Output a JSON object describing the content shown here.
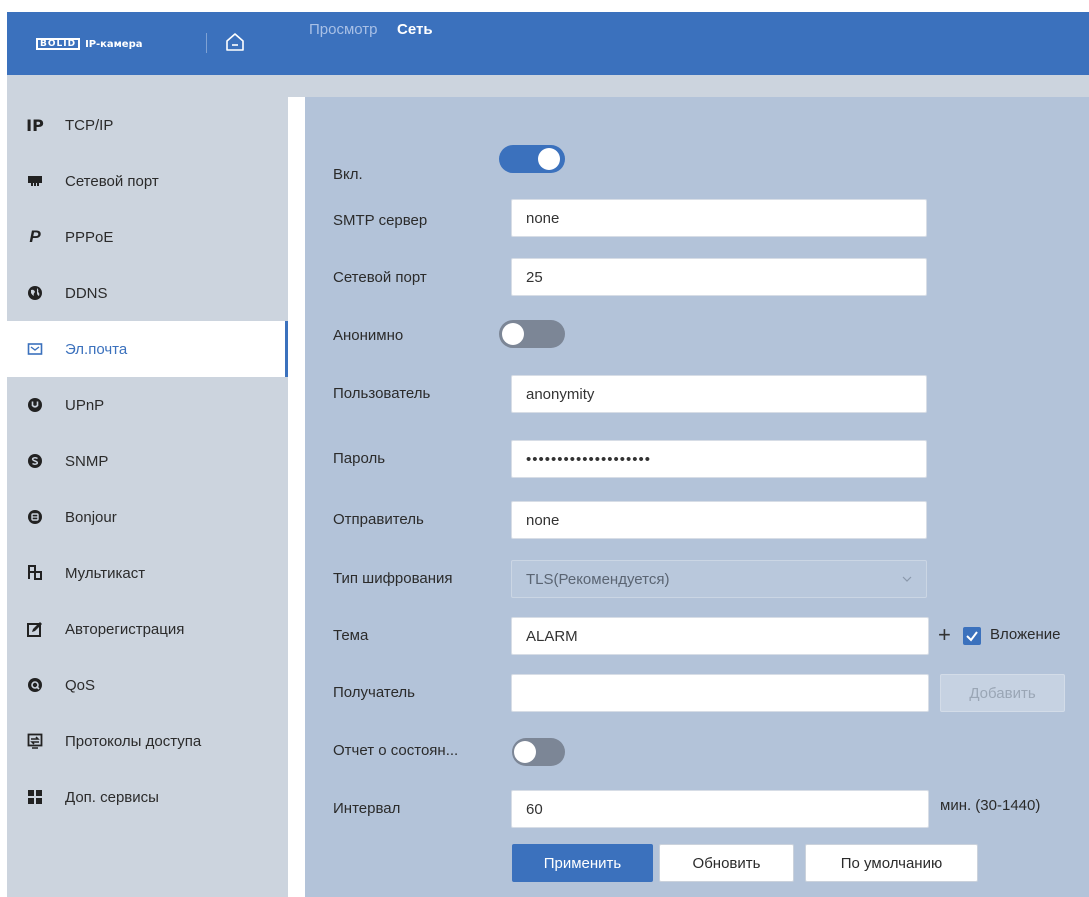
{
  "header": {
    "logo_brand": "BOLID",
    "logo_text": "IP-камера",
    "nav": [
      {
        "label": "Просмотр"
      },
      {
        "label": "Сеть"
      }
    ],
    "accent_color": "#3b71bd"
  },
  "sidebar": {
    "items": [
      {
        "label": "TCP/IP",
        "icon": "ip-icon"
      },
      {
        "label": "Сетевой порт",
        "icon": "network-port-icon"
      },
      {
        "label": "PPPoE",
        "icon": "pppoe-icon"
      },
      {
        "label": "DDNS",
        "icon": "globe-icon"
      },
      {
        "label": "Эл.почта",
        "icon": "mail-icon",
        "active": true
      },
      {
        "label": "UPnP",
        "icon": "upnp-icon"
      },
      {
        "label": "SNMP",
        "icon": "snmp-icon"
      },
      {
        "label": "Bonjour",
        "icon": "bonjour-icon"
      },
      {
        "label": "Мультикаст",
        "icon": "multicast-icon"
      },
      {
        "label": "Авторегистрация",
        "icon": "auto-register-icon"
      },
      {
        "label": "QoS",
        "icon": "qos-icon"
      },
      {
        "label": "Протоколы доступа",
        "icon": "access-protocol-icon"
      },
      {
        "label": "Доп. сервисы",
        "icon": "services-icon"
      }
    ]
  },
  "form": {
    "enable_label": "Вкл.",
    "enable_on": true,
    "smtp_label": "SMTP сервер",
    "smtp_value": "none",
    "port_label": "Сетевой порт",
    "port_value": "25",
    "anonymous_label": "Анонимно",
    "anonymous_on": false,
    "user_label": "Пользователь",
    "user_value": "anonymity",
    "password_label": "Пароль",
    "password_value": "••••••••••••••••••••",
    "sender_label": "Отправитель",
    "sender_value": "none",
    "encryption_label": "Тип шифрования",
    "encryption_value": "TLS(Рекомендуется)",
    "subject_label": "Тема",
    "subject_value": "ALARM",
    "attachment_label": "Вложение",
    "attachment_checked": true,
    "recipient_label": "Получатель",
    "recipient_value": "",
    "add_button": "Добавить",
    "status_report_label": "Отчет о состоян...",
    "status_report_on": false,
    "interval_label": "Интервал",
    "interval_value": "60",
    "interval_unit": "мин. (30-1440)"
  },
  "actions": {
    "apply": "Применить",
    "refresh": "Обновить",
    "default": "По умолчанию"
  }
}
